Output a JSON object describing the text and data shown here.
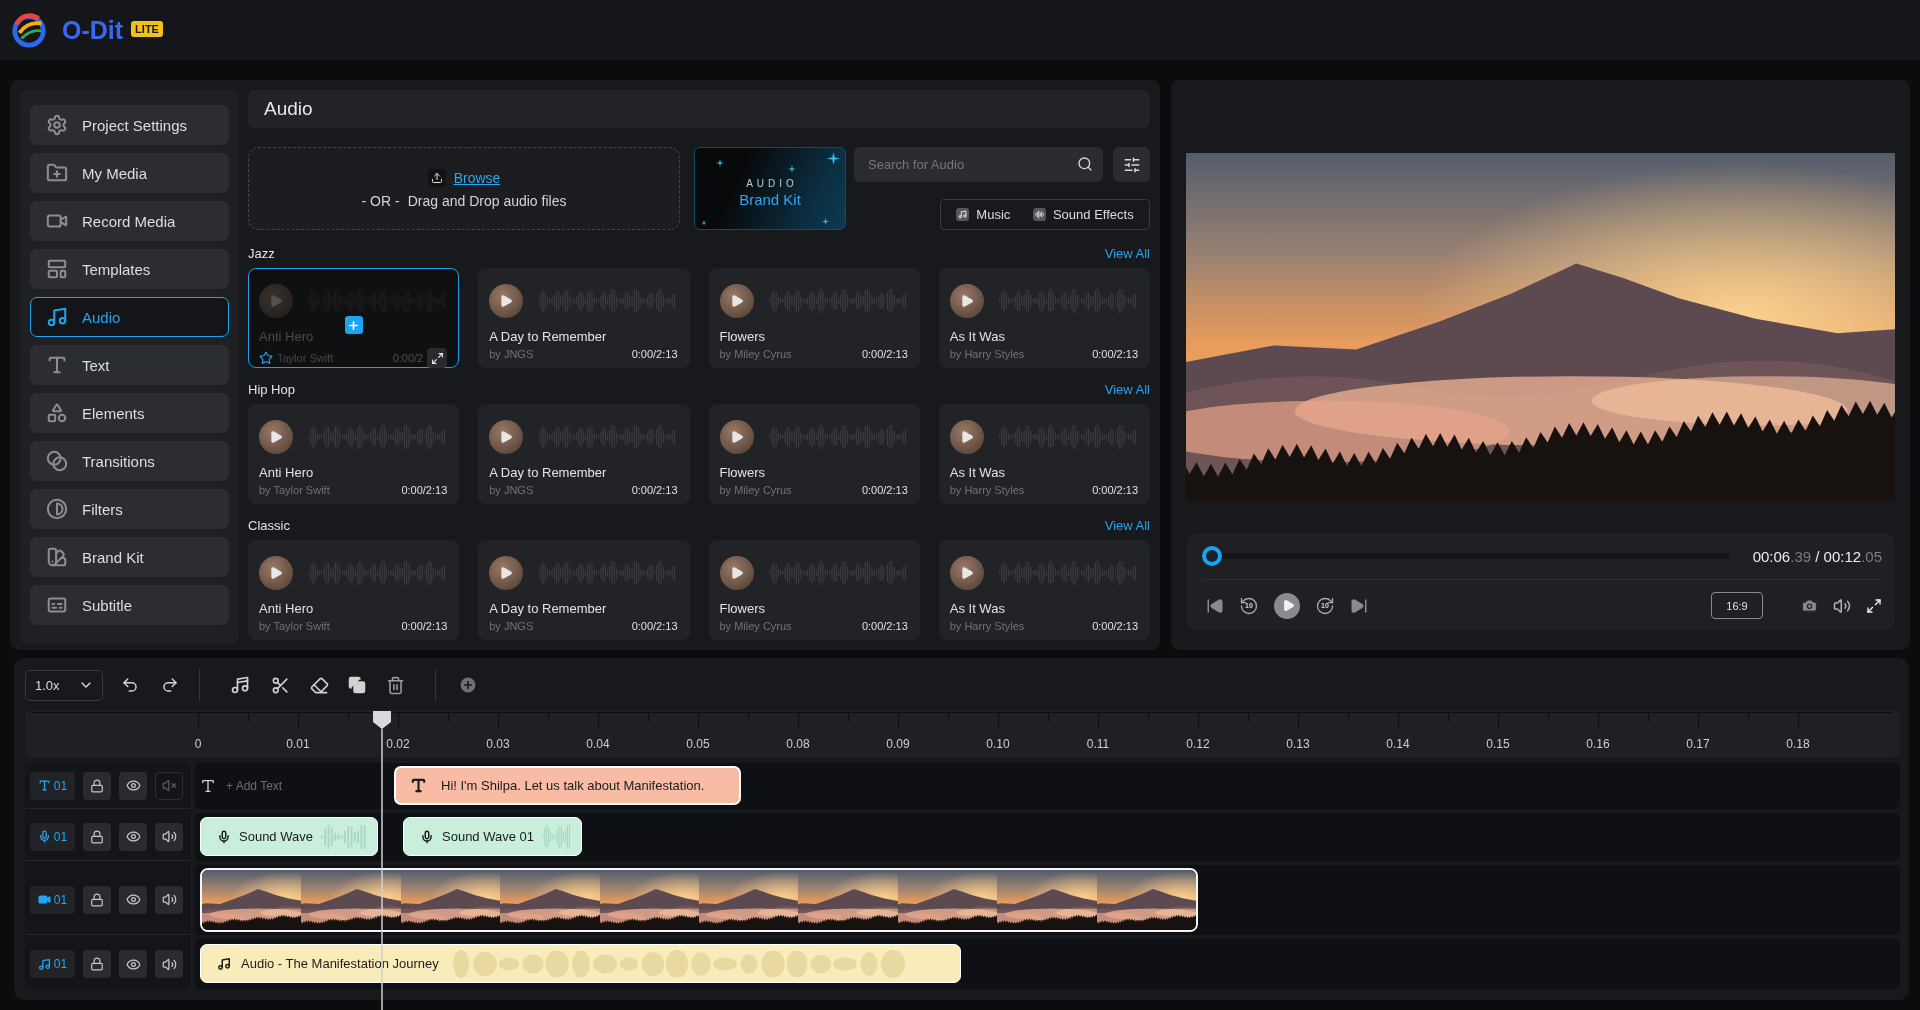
{
  "header": {
    "brand": "O-Dit",
    "badge": "LITE"
  },
  "sidebar": {
    "items": [
      {
        "label": "Project Settings",
        "kind": "settings",
        "selected": false
      },
      {
        "label": "My Media",
        "kind": "media",
        "selected": false
      },
      {
        "label": "Record Media",
        "kind": "record",
        "selected": false
      },
      {
        "label": "Templates",
        "kind": "templates",
        "selected": false
      },
      {
        "label": "Audio",
        "kind": "audio",
        "selected": true
      },
      {
        "label": "Text",
        "kind": "text",
        "selected": false
      },
      {
        "label": "Elements",
        "kind": "elements",
        "selected": false
      },
      {
        "label": "Transitions",
        "kind": "transitions",
        "selected": false
      },
      {
        "label": "Filters",
        "kind": "filters",
        "selected": false
      },
      {
        "label": "Brand Kit",
        "kind": "brand",
        "selected": false
      },
      {
        "label": "Subtitle",
        "kind": "subtitle",
        "selected": false
      }
    ]
  },
  "audio_panel": {
    "title": "Audio",
    "upload": {
      "link": "Browse",
      "separator": "- OR -",
      "hint": "Drag and Drop audio files"
    },
    "brand_kit": {
      "overline": "AUDIO",
      "title": "Brand Kit"
    },
    "search": {
      "placeholder": "Search for Audio"
    },
    "filters": [
      {
        "label": "Music",
        "kind": "music"
      },
      {
        "label": "Sound Effects",
        "kind": "effects"
      }
    ],
    "sections": [
      {
        "title": "Jazz",
        "link": "View All",
        "tracks": [
          {
            "title": "Anti Hero",
            "artist": "Taylor Swift",
            "time": "0:00/2",
            "selected": true
          },
          {
            "title": "A Day to Remember",
            "artist": "by JNGS",
            "time": "0:00/2:13",
            "selected": false
          },
          {
            "title": "Flowers",
            "artist": "by Miley Cyrus",
            "time": "0:00/2:13",
            "selected": false
          },
          {
            "title": "As It Was",
            "artist": "by Harry Styles",
            "time": "0:00/2:13",
            "selected": false
          }
        ]
      },
      {
        "title": "Hip Hop",
        "link": "View All",
        "tracks": [
          {
            "title": "Anti Hero",
            "artist": "by Taylor Swift",
            "time": "0:00/2:13",
            "selected": false
          },
          {
            "title": "A Day to Remember",
            "artist": "by JNGS",
            "time": "0:00/2:13",
            "selected": false
          },
          {
            "title": "Flowers",
            "artist": "by Miley Cyrus",
            "time": "0:00/2:13",
            "selected": false
          },
          {
            "title": "As It Was",
            "artist": "by Harry Styles",
            "time": "0:00/2:13",
            "selected": false
          }
        ]
      },
      {
        "title": "Classic",
        "link": "View All",
        "tracks": [
          {
            "title": "Anti Hero",
            "artist": "by Taylor Swift",
            "time": "0:00/2:13",
            "selected": false
          },
          {
            "title": "A Day to Remember",
            "artist": "by JNGS",
            "time": "0:00/2:13",
            "selected": false
          },
          {
            "title": "Flowers",
            "artist": "by Miley Cyrus",
            "time": "0:00/2:13",
            "selected": false
          },
          {
            "title": "As It Was",
            "artist": "by Harry Styles",
            "time": "0:00/2:13",
            "selected": false
          }
        ]
      }
    ]
  },
  "preview": {
    "time": {
      "elapsed": "00:06",
      "elapsed_fraction": ".39",
      "separator": "/",
      "duration": "00:12",
      "duration_fraction": ".05"
    },
    "progress": {
      "level": 0
    },
    "rewind_label": "10",
    "forward_label": "10",
    "aspect_ratio": "16:9"
  },
  "timeline": {
    "speed": "1.0x",
    "ruler": [
      "0",
      "0.01",
      "0.02",
      "0.03",
      "0.04",
      "0.05",
      "0.08",
      "0.09",
      "0.10",
      "0.11",
      "0.12",
      "0.13",
      "0.14",
      "0.15",
      "0.16",
      "0.17",
      "0.18"
    ],
    "tracks": [
      {
        "kind": "text",
        "label": "01",
        "audio_off": true,
        "add_label": "+ Add Text",
        "clips": [
          {
            "kind": "text",
            "label": "Hi! I'm Shilpa. Let us talk about Manifestation."
          }
        ]
      },
      {
        "kind": "voice",
        "label": "01",
        "audio_off": false,
        "clips": [
          {
            "kind": "voice",
            "label": "Sound Wave"
          },
          {
            "kind": "voice",
            "label": "Sound Wave 01"
          }
        ]
      },
      {
        "kind": "video",
        "label": "01",
        "audio_off": false,
        "clips": [
          {
            "kind": "video"
          }
        ]
      },
      {
        "kind": "music",
        "label": "01",
        "audio_off": false,
        "clips": [
          {
            "kind": "music",
            "label": "Audio - The Manifestation Journey"
          }
        ]
      }
    ]
  }
}
